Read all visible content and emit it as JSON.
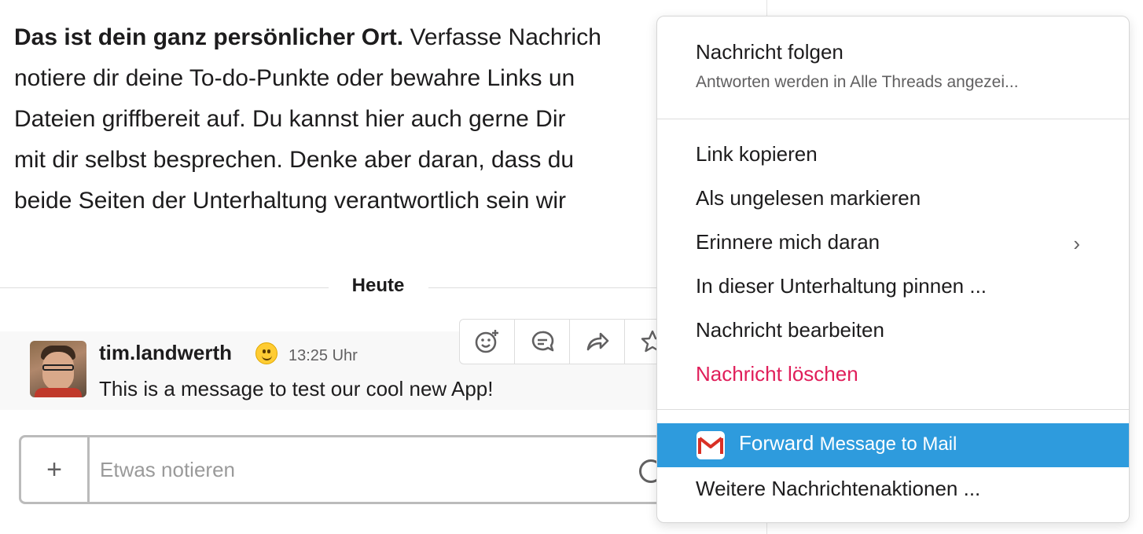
{
  "intro": {
    "bold": "Das ist dein ganz persönlicher Ort.",
    "line1_rest": " Verfasse Nachrich",
    "line2": "notiere dir deine To-do-Punkte oder bewahre Links un",
    "line3": "Dateien griffbereit auf. Du kannst hier auch gerne Dir",
    "line4": "mit dir selbst besprechen. Denke aber daran, dass du",
    "line5": "beide Seiten der Unterhaltung verantwortlich sein wir"
  },
  "day_divider": "Heute",
  "message": {
    "username": "tim.landwerth",
    "time": "13:25 Uhr",
    "text": "This is a message to test our cool new App!"
  },
  "message_actions": [
    "emoji-reaction-icon",
    "reply-thread-icon",
    "share-icon",
    "star-icon"
  ],
  "composer": {
    "plus": "+",
    "placeholder": "Etwas notieren"
  },
  "menu": {
    "follow_label": "Nachricht folgen",
    "follow_sub": "Antworten werden in Alle Threads angezei...",
    "items": [
      "Link kopieren",
      "Als ungelesen markieren",
      "Erinnere mich daran",
      "In dieser Unterhaltung pinnen ...",
      "Nachricht bearbeiten",
      "Nachricht löschen"
    ],
    "forward_main": "Forward",
    "forward_rest": "Message to Mail",
    "more_actions": "Weitere Nachrichtenaktionen ...",
    "chevron": "›"
  },
  "colors": {
    "highlight": "#2e9bdd",
    "danger": "#e01e5a",
    "text": "#1d1c1d",
    "muted": "#616061"
  }
}
